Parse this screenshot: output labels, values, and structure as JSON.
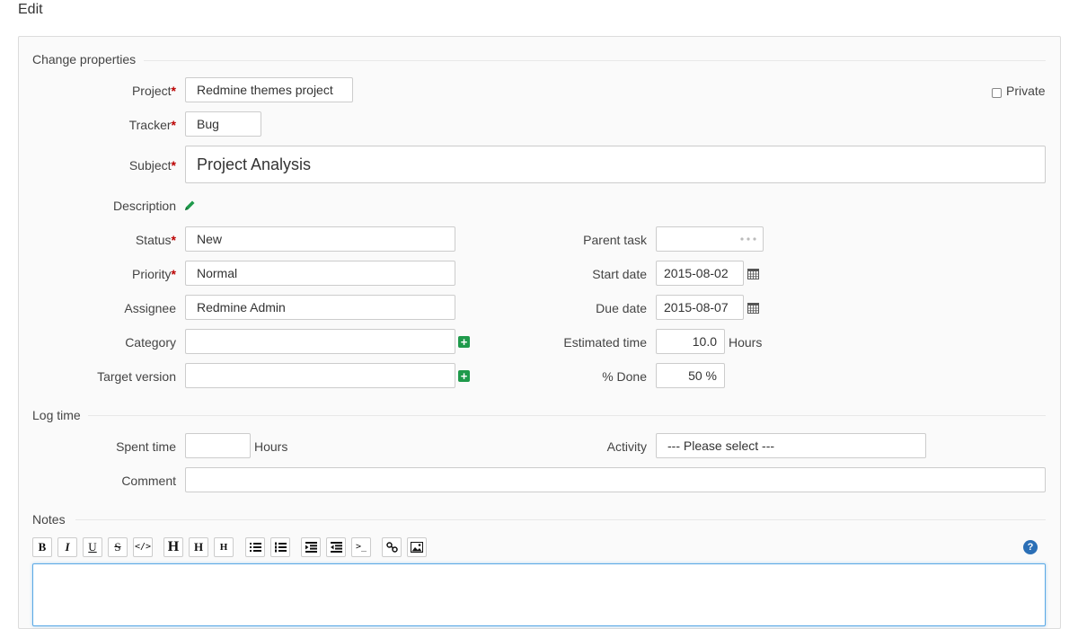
{
  "page": {
    "title": "Edit"
  },
  "properties": {
    "legend": "Change properties",
    "project": {
      "label": "Project",
      "value": "Redmine themes project"
    },
    "private": {
      "label": "Private",
      "checked": false
    },
    "tracker": {
      "label": "Tracker",
      "value": "Bug"
    },
    "subject": {
      "label": "Subject",
      "value": "Project Analysis"
    },
    "description": {
      "label": "Description"
    },
    "status": {
      "label": "Status",
      "value": "New"
    },
    "priority": {
      "label": "Priority",
      "value": "Normal"
    },
    "assignee": {
      "label": "Assignee",
      "value": "Redmine Admin"
    },
    "category": {
      "label": "Category",
      "value": ""
    },
    "target_version": {
      "label": "Target version",
      "value": ""
    },
    "parent_task": {
      "label": "Parent task",
      "value": ""
    },
    "start_date": {
      "label": "Start date",
      "value": "2015-08-02"
    },
    "due_date": {
      "label": "Due date",
      "value": "2015-08-07"
    },
    "estimated_time": {
      "label": "Estimated time",
      "value": "10.0",
      "unit": "Hours"
    },
    "done": {
      "label": "% Done",
      "value": "50 %"
    },
    "required_mark": "*"
  },
  "log_time": {
    "legend": "Log time",
    "spent_time": {
      "label": "Spent time",
      "value": "",
      "unit": "Hours"
    },
    "activity": {
      "label": "Activity",
      "value": "--- Please select ---"
    },
    "comment": {
      "label": "Comment",
      "value": ""
    }
  },
  "notes": {
    "legend": "Notes",
    "toolbar": {
      "bold": "B",
      "italic": "I",
      "underline": "U",
      "strike": "S",
      "code": "</>",
      "h1": "H",
      "h2": "H",
      "h3": "H",
      "prompt": ">_"
    },
    "help": "?"
  },
  "colors": {
    "required": "#bb0000",
    "add": "#1f9a4b",
    "edit_icon": "#1f9a4b",
    "help": "#2b6fb6",
    "focus": "#5aa9e6"
  }
}
